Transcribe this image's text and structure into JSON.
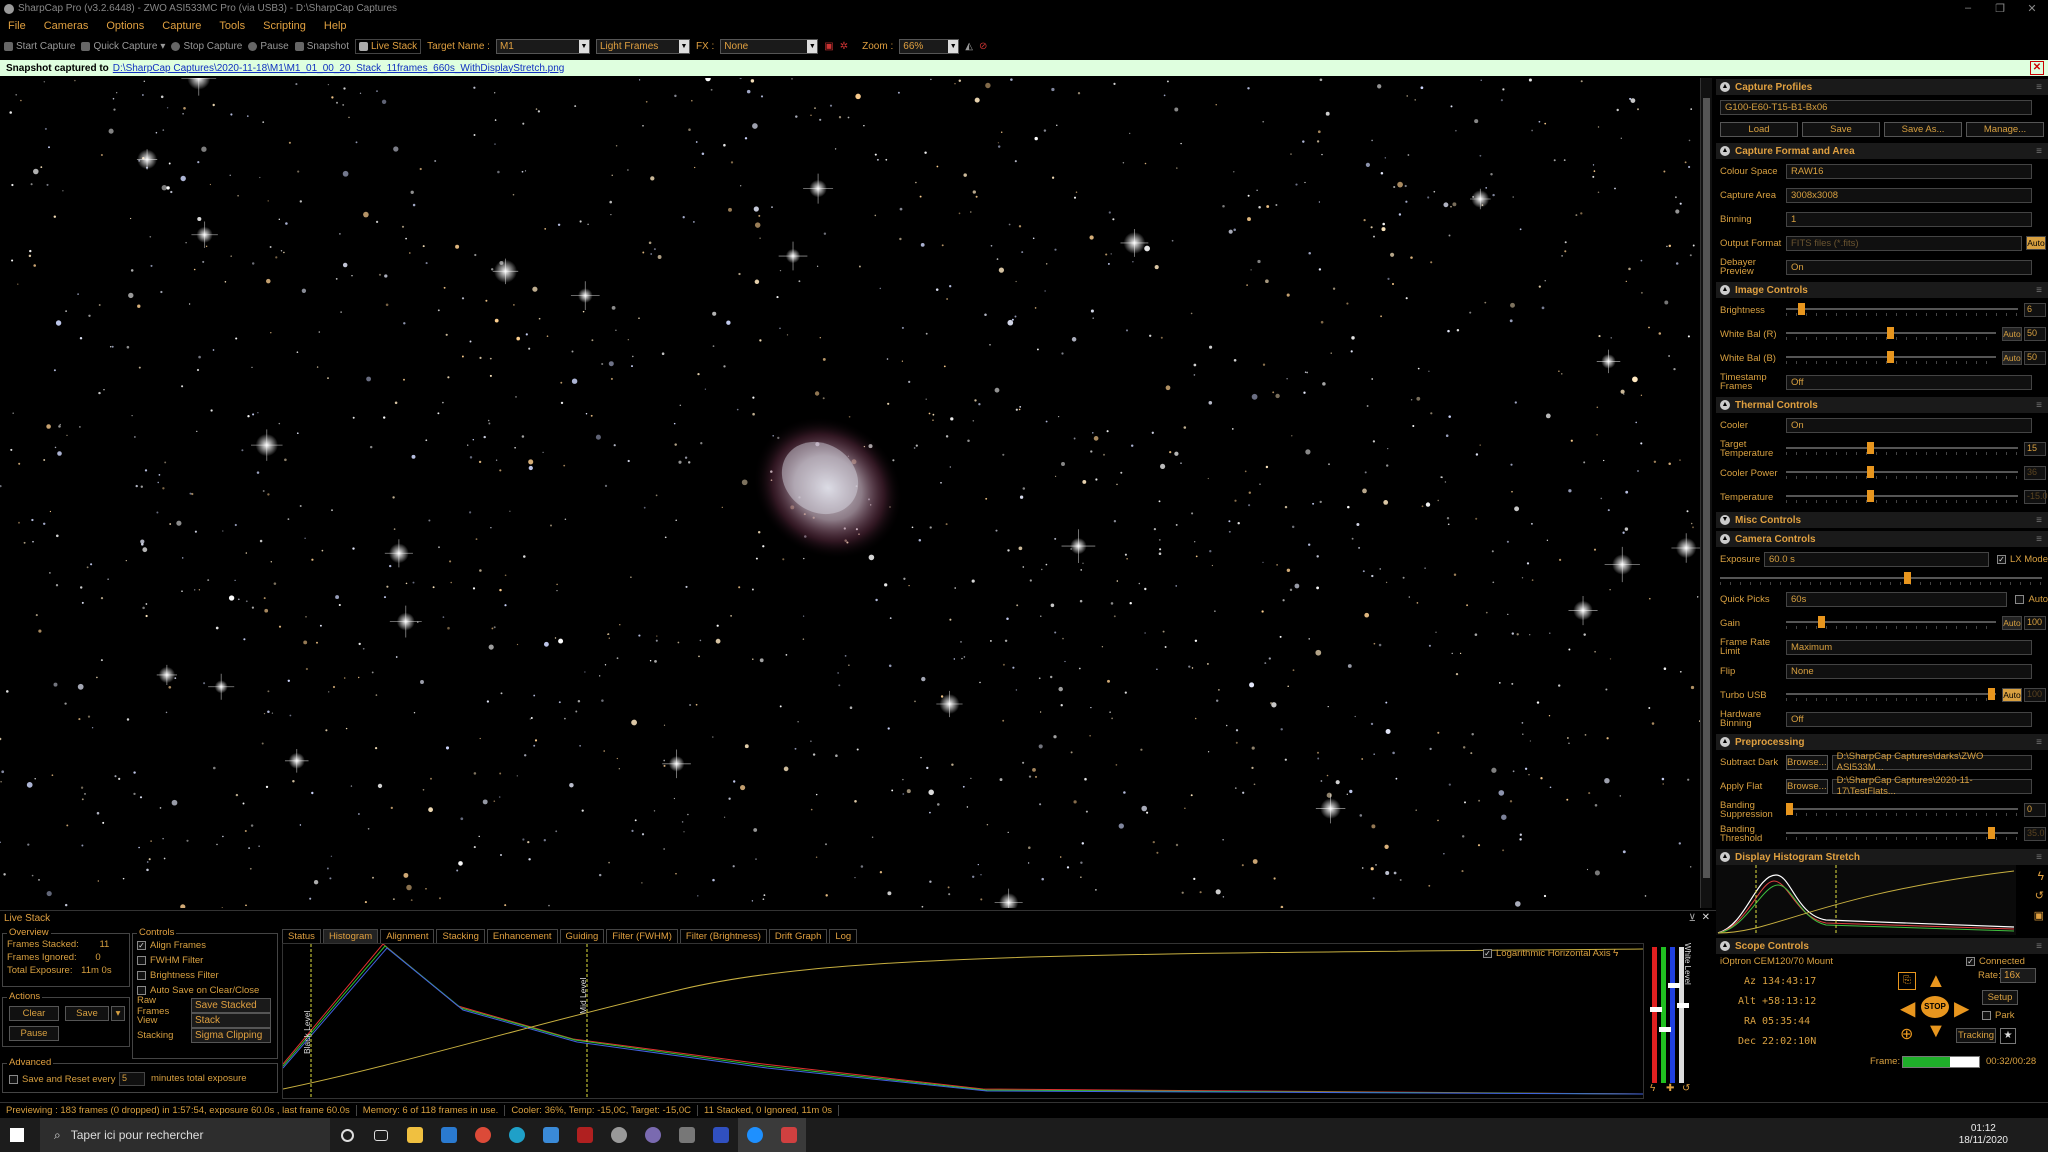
{
  "window": {
    "title": "SharpCap Pro (v3.2.6448) - ZWO ASI533MC Pro (via USB3) - D:\\SharpCap Captures"
  },
  "menu": [
    "File",
    "Cameras",
    "Options",
    "Capture",
    "Tools",
    "Scripting",
    "Help"
  ],
  "toolbar": {
    "start_capture": "Start Capture",
    "quick_capture": "Quick Capture",
    "stop_capture": "Stop Capture",
    "pause": "Pause",
    "snapshot": "Snapshot",
    "live_stack": "Live Stack",
    "target_label": "Target Name :",
    "target_value": "M1",
    "frames_type": "Light Frames",
    "fx_label": "FX :",
    "fx_value": "None",
    "zoom_label": "Zoom :",
    "zoom_value": "66%"
  },
  "notice": {
    "text": "Snapshot captured to",
    "path": "D:\\SharpCap Captures\\2020-11-18\\M1\\M1_01_00_20_Stack_11frames_660s_WithDisplayStretch.png"
  },
  "panel": {
    "capture_profiles": {
      "title": "Capture Profiles",
      "selected": "G100-E60-T15-B1-Bx06",
      "load": "Load",
      "save": "Save",
      "save_as": "Save As...",
      "manage": "Manage..."
    },
    "format": {
      "title": "Capture Format and Area",
      "colour_space_label": "Colour Space",
      "colour_space": "RAW16",
      "capture_area_label": "Capture Area",
      "capture_area": "3008x3008",
      "binning_label": "Binning",
      "binning": "1",
      "output_format_label": "Output Format",
      "output_format": "FITS files (*.fits)",
      "output_auto": "Auto",
      "debayer_label": "Debayer Preview",
      "debayer": "On"
    },
    "image": {
      "title": "Image Controls",
      "brightness_label": "Brightness",
      "brightness": "6",
      "wb_r_label": "White Bal (R)",
      "wb_r": "50",
      "wb_b_label": "White Bal (B)",
      "wb_b": "50",
      "auto": "Auto",
      "timestamp_label": "Timestamp Frames",
      "timestamp": "Off"
    },
    "thermal": {
      "title": "Thermal Controls",
      "cooler_label": "Cooler",
      "cooler": "On",
      "target_temp_label": "Target Temperature",
      "target_temp": "15",
      "cooler_power_label": "Cooler Power",
      "cooler_power": "36",
      "temperature_label": "Temperature",
      "temperature": "-15.0"
    },
    "misc": {
      "title": "Misc Controls"
    },
    "camera": {
      "title": "Camera Controls",
      "exposure_label": "Exposure",
      "exposure": "60.0 s",
      "lx_mode": "LX Mode",
      "quick_picks_label": "Quick Picks",
      "quick_picks": "60s",
      "quick_auto": "Auto",
      "gain_label": "Gain",
      "gain": "100",
      "frame_rate_label": "Frame Rate Limit",
      "frame_rate": "Maximum",
      "flip_label": "Flip",
      "flip": "None",
      "turbo_label": "Turbo USB",
      "turbo": "100",
      "hw_binning_label": "Hardware Binning",
      "hw_binning": "Off"
    },
    "preprocessing": {
      "title": "Preprocessing",
      "subtract_dark_label": "Subtract Dark",
      "browse": "Browse...",
      "subtract_dark": "D:\\SharpCap Captures\\darks\\ZWO ASI533M...",
      "apply_flat_label": "Apply Flat",
      "apply_flat": "D:\\SharpCap Captures\\2020-11-17\\TestFlats...",
      "banding_supp_label": "Banding Suppression",
      "banding_supp": "0",
      "banding_thr_label": "Banding Threshold",
      "banding_thr": "35.0"
    },
    "histogram": {
      "title": "Display Histogram Stretch"
    },
    "scope": {
      "title": "Scope Controls",
      "mount": "iOptron CEM120/70 Mount",
      "connected": "Connected",
      "rate_label": "Rate:",
      "rate": "16x",
      "az_label": "Az",
      "az": "134:43:17",
      "alt_label": "Alt",
      "alt": "+58:13:12",
      "ra_label": "RA",
      "ra": "05:35:44",
      "dec_label": "Dec",
      "dec": "22:02:10N",
      "setup": "Setup",
      "park": "Park",
      "tracking": "Tracking",
      "stop": "STOP"
    },
    "frame": {
      "label": "Frame:",
      "time": "00:32/00:28",
      "progress": 0.62
    }
  },
  "livestack": {
    "title": "Live Stack",
    "overview_title": "Overview",
    "frames_stacked_label": "Frames Stacked:",
    "frames_stacked": "11",
    "frames_ignored_label": "Frames Ignored:",
    "frames_ignored": "0",
    "total_exposure_label": "Total Exposure:",
    "total_exposure": "11m 0s",
    "actions_title": "Actions",
    "clear": "Clear",
    "save": "Save",
    "pause": "Pause",
    "controls_title": "Controls",
    "align": "Align Frames",
    "fwhm": "FWHM Filter",
    "brightness": "Brightness Filter",
    "autosave": "Auto Save on Clear/Close",
    "raw_frames_label": "Raw Frames",
    "raw_frames": "Save Stacked",
    "view_label": "View",
    "view": "Stack",
    "stacking_label": "Stacking",
    "stacking": "Sigma Clipping",
    "advanced_title": "Advanced",
    "save_reset": "Save and Reset every",
    "minutes": "minutes total exposure",
    "minutes_value": "5",
    "tabs": [
      "Status",
      "Histogram",
      "Alignment",
      "Stacking",
      "Enhancement",
      "Guiding",
      "Filter (FWHM)",
      "Filter (Brightness)",
      "Drift Graph",
      "Log"
    ],
    "log_axis": "Logarithmic Horizontal Axis",
    "black_level": "Black Level",
    "mid_level": "Mid Level",
    "white_level": "White Level"
  },
  "status": {
    "preview": "Previewing : 183 frames (0 dropped) in 1:57:54, exposure 60.0s , last frame 60.0s",
    "memory": "Memory: 6 of 118 frames in use.",
    "cooler": "Cooler: 36%, Temp: -15,0C, Target: -15,0C",
    "stacked": "11 Stacked, 0 Ignored, 11m 0s"
  },
  "taskbar": {
    "search": "Taper ici pour rechercher",
    "time": "01:12",
    "date": "18/11/2020"
  },
  "colors": {
    "accent": "#e0a040",
    "knob": "#e8961e",
    "notice_bg": "#dfffdf",
    "link": "#1030c0"
  }
}
